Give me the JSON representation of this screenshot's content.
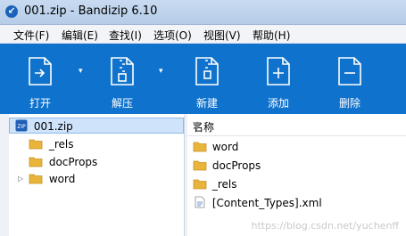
{
  "window": {
    "title": "001.zip - Bandizip 6.10"
  },
  "menu": [
    "文件(F)",
    "编辑(E)",
    "查找(I)",
    "选项(O)",
    "视图(V)",
    "帮助(H)"
  ],
  "toolbar": {
    "open": "打开",
    "extract": "解压",
    "new": "新建",
    "add": "添加",
    "delete": "删除"
  },
  "tree": {
    "root": "001.zip",
    "children": [
      "_rels",
      "docProps",
      "word"
    ]
  },
  "list": {
    "column_name": "名称",
    "items": [
      "word",
      "docProps",
      "_rels",
      "[Content_Types].xml"
    ]
  },
  "watermark": "https://blog.csdn.net/yuchenff",
  "colors": {
    "toolbar": "#0f72cc",
    "folder": "#e8b53a",
    "selection": "#cfe3fb"
  }
}
